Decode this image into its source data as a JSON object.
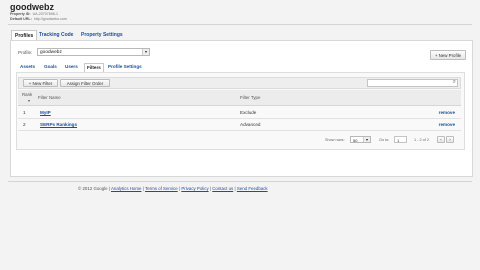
{
  "header": {
    "title": "goodwebz",
    "property_id_label": "Property ID:",
    "property_id_value": "UA-20707898-1",
    "default_url_label": "Default URL:",
    "default_url_value": "http://goodwebz.com"
  },
  "top_tabs": [
    {
      "label": "Profiles",
      "active": true
    },
    {
      "label": "Tracking Code",
      "active": false
    },
    {
      "label": "Property Settings",
      "active": false
    }
  ],
  "profile": {
    "label": "Profile:",
    "selected": "goodwebz",
    "new_profile_label": "+ New Profile"
  },
  "sub_tabs": [
    {
      "label": "Assets",
      "active": false
    },
    {
      "label": "Goals",
      "active": false
    },
    {
      "label": "Users",
      "active": false
    },
    {
      "label": "Filters",
      "active": true
    },
    {
      "label": "Profile Settings",
      "active": false
    }
  ],
  "toolbar": {
    "new_filter_label": "+ New Filter",
    "assign_order_label": "Assign Filter Order",
    "search_placeholder": ""
  },
  "table": {
    "headers": {
      "rank": "Rank",
      "name": "Filter Name",
      "type": "Filter Type"
    },
    "rows": [
      {
        "rank": "1",
        "name": "MyIP",
        "type": "Exclude",
        "action": "remove"
      },
      {
        "rank": "2",
        "name": "SERPs Rankings",
        "type": "Advanced",
        "action": "remove"
      }
    ]
  },
  "pagination": {
    "show_rows_label": "Show rows:",
    "show_rows_value": "50",
    "go_to_label": "Go to:",
    "go_to_value": "1",
    "range_text": "1 - 2 of 2",
    "prev": "‹",
    "next": "›"
  },
  "footer": {
    "copyright": "© 2012 Google",
    "sep": "|",
    "links": [
      "Analytics Home",
      "Terms of Service",
      "Privacy Policy",
      "Contact us",
      "Send Feedback"
    ]
  }
}
